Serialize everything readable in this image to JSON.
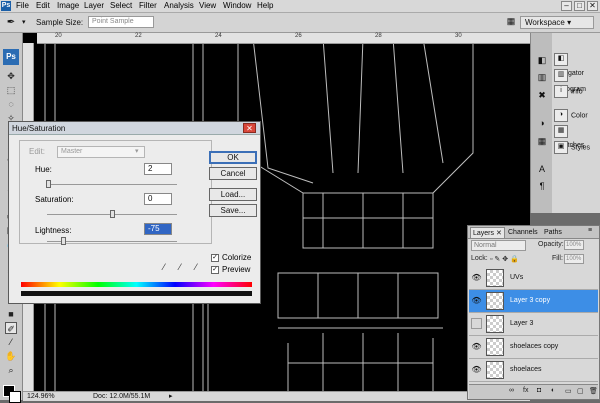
{
  "menubar": {
    "app_icon": "Ps",
    "items": [
      "File",
      "Edit",
      "Image",
      "Layer",
      "Select",
      "Filter",
      "Analysis",
      "View",
      "Window",
      "Help"
    ],
    "window_buttons": [
      "–",
      "□",
      "✕"
    ]
  },
  "options_bar": {
    "sample_size_label": "Sample Size:",
    "sample_size_value": "Point Sample",
    "workspace_label": "Workspace ▾"
  },
  "toolbox": {
    "logo": "Ps"
  },
  "ruler": {
    "ticks": [
      "20",
      "22",
      "24",
      "26",
      "28",
      "30"
    ]
  },
  "status": {
    "zoom": "124.96%",
    "doc": "Doc: 12.0M/55.1M"
  },
  "dock": {
    "panels": [
      "Navigator",
      "Histogram",
      "Info",
      "Color",
      "Swatches",
      "Styles"
    ]
  },
  "hue_sat_dialog": {
    "title": "Hue/Saturation",
    "edit_label": "Edit:",
    "edit_value": "Master",
    "hue_label": "Hue:",
    "hue_value": "2",
    "saturation_label": "Saturation:",
    "saturation_value": "0",
    "lightness_label": "Lightness:",
    "lightness_value": "-75",
    "ok_label": "OK",
    "cancel_label": "Cancel",
    "load_label": "Load...",
    "save_label": "Save...",
    "colorize_label": "Colorize",
    "preview_label": "Preview",
    "colorize_checked": true,
    "preview_checked": true,
    "slider_levels": {
      "hue": 0.01,
      "saturation": 0.5,
      "lightness": 0.125
    }
  },
  "layers_panel": {
    "tabs": [
      "Layers ✕",
      "Channels",
      "Paths"
    ],
    "blend_mode": "Normal",
    "opacity_label": "Opacity:",
    "opacity_value": "100%",
    "lock_label": "Lock:",
    "fill_label": "Fill:",
    "fill_value": "100%",
    "layers": [
      {
        "name": "UVs",
        "visible": true,
        "selected": false
      },
      {
        "name": "Layer 3 copy",
        "visible": true,
        "selected": true
      },
      {
        "name": "Layer 3",
        "visible": false,
        "selected": false
      },
      {
        "name": "shoelaces copy",
        "visible": true,
        "selected": false
      },
      {
        "name": "shoelaces",
        "visible": true,
        "selected": false
      }
    ]
  },
  "colors": {
    "selected_layer": "#3d8ee6",
    "canvas_bg": "#000000",
    "uv_lines": "#bdbdbd"
  }
}
